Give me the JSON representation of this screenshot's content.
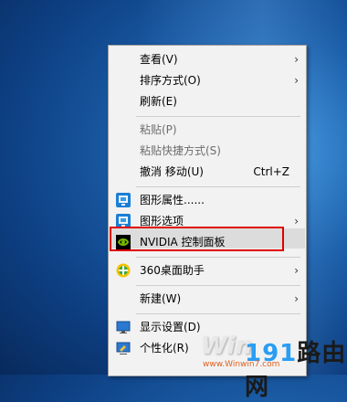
{
  "menu": {
    "items": [
      {
        "label": "查看(V)",
        "submenu": true,
        "disabled": false
      },
      {
        "label": "排序方式(O)",
        "submenu": true,
        "disabled": false
      },
      {
        "label": "刷新(E)",
        "submenu": false,
        "disabled": false
      },
      {
        "label": "粘贴(P)",
        "submenu": false,
        "disabled": true
      },
      {
        "label": "粘贴快捷方式(S)",
        "submenu": false,
        "disabled": true
      },
      {
        "label": "撤消 移动(U)",
        "shortcut": "Ctrl+Z",
        "submenu": false,
        "disabled": false
      },
      {
        "label": "图形属性......",
        "icon": "intel-graphics-icon",
        "submenu": false,
        "disabled": false
      },
      {
        "label": "图形选项",
        "icon": "intel-graphics-icon",
        "submenu": true,
        "disabled": false
      },
      {
        "label": "NVIDIA 控制面板",
        "icon": "nvidia-icon",
        "submenu": false,
        "disabled": false,
        "highlighted": true
      },
      {
        "label": "360桌面助手",
        "icon": "360-icon",
        "submenu": true,
        "disabled": false
      },
      {
        "label": "新建(W)",
        "submenu": true,
        "disabled": false
      },
      {
        "label": "显示设置(D)",
        "icon": "display-icon",
        "submenu": false,
        "disabled": false
      },
      {
        "label": "个性化(R)",
        "icon": "personalize-icon",
        "submenu": false,
        "disabled": false
      }
    ]
  },
  "watermark": {
    "brand_text": "191路由网",
    "brand_number": "191",
    "brand_rest": "路由网",
    "logo_text": "Win",
    "url_text": "www.Winwin7.com"
  },
  "colors": {
    "highlight_box": "#e00000",
    "menu_bg": "#f2f2f2",
    "nvidia_green": "#76b900"
  }
}
